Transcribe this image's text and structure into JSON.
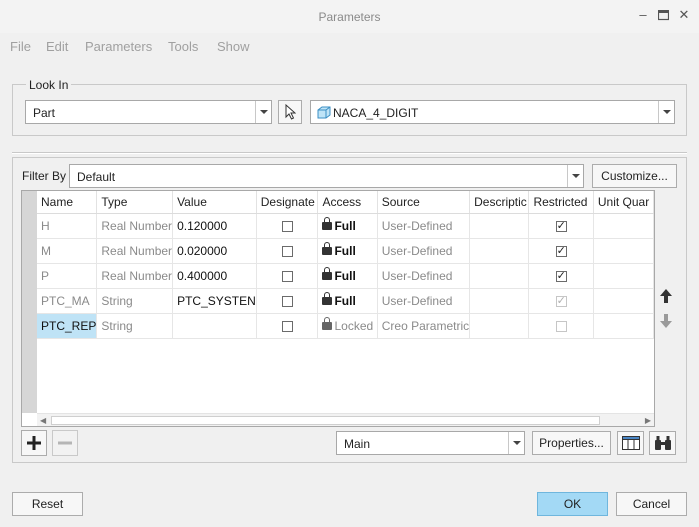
{
  "window": {
    "title": "Parameters"
  },
  "menu": [
    "File",
    "Edit",
    "Parameters",
    "Tools",
    "Show"
  ],
  "look_in": {
    "legend": "Look In",
    "type_value": "Part",
    "model_value": "NACA_4_DIGIT"
  },
  "filter": {
    "label": "Filter By",
    "value": "Default",
    "customize_label": "Customize..."
  },
  "table": {
    "columns": [
      "Name",
      "Type",
      "Value",
      "Designate",
      "Access",
      "Source",
      "Descriptic",
      "Restricted",
      "Unit Quar"
    ],
    "rows": [
      {
        "name": "H",
        "type": "Real Number",
        "value": "0.120000",
        "designate": false,
        "access": "Full",
        "source": "User-Defined",
        "description": "",
        "restricted": true,
        "restricted_disabled": false
      },
      {
        "name": "M",
        "type": "Real Number",
        "value": "0.020000",
        "designate": false,
        "access": "Full",
        "source": "User-Defined",
        "description": "",
        "restricted": true,
        "restricted_disabled": false
      },
      {
        "name": "P",
        "type": "Real Number",
        "value": "0.400000",
        "designate": false,
        "access": "Full",
        "source": "User-Defined",
        "description": "",
        "restricted": true,
        "restricted_disabled": false
      },
      {
        "name": "PTC_MA",
        "type": "String",
        "value": "PTC_SYSTEN",
        "designate": false,
        "access": "Full",
        "source": "User-Defined",
        "description": "",
        "restricted": true,
        "restricted_disabled": true
      },
      {
        "name": "PTC_REP",
        "type": "String",
        "value": "",
        "designate": false,
        "access": "Locked",
        "source": "Creo Parametric",
        "description": "",
        "restricted": false,
        "restricted_disabled": true
      }
    ]
  },
  "bottom_bar": {
    "main_value": "Main",
    "properties_label": "Properties..."
  },
  "footer": {
    "reset_label": "Reset",
    "ok_label": "OK",
    "cancel_label": "Cancel"
  },
  "icons": [
    "minimize-icon",
    "maximize-icon",
    "close-icon",
    "select-arrow-icon",
    "part-icon",
    "add-icon",
    "remove-icon",
    "move-up-icon",
    "move-down-icon",
    "table-columns-icon",
    "binoculars-icon",
    "lock-icon"
  ]
}
